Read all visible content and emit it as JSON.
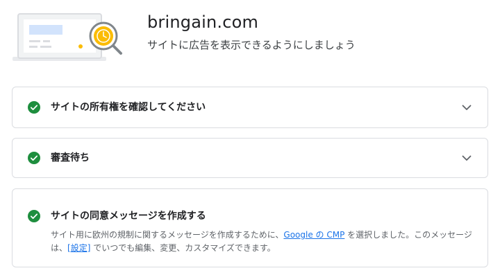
{
  "header": {
    "site_name": "bringain.com",
    "subtitle": "サイトに広告を表示できるようにしましょう"
  },
  "steps": [
    {
      "title": "サイトの所有権を確認してください",
      "status": "complete"
    },
    {
      "title": "審査待ち",
      "status": "complete"
    },
    {
      "title": "サイトの同意メッセージを作成する",
      "status": "complete",
      "desc_part1": "サイト用に欧州の規制に関するメッセージを作成するために、",
      "desc_link1": "Google の CMP",
      "desc_part2": " を選択しました。このメッセージは、",
      "desc_link2": "[設定]",
      "desc_part3": " でいつでも編集、変更、カスタマイズできます。"
    }
  ],
  "colors": {
    "success": "#1e8e3e",
    "link": "#1a73e8",
    "illustration_accent": "#fbbc04",
    "illustration_blue": "#d2e3fc"
  },
  "icons": {
    "status": "check-circle-icon",
    "expand": "chevron-down-icon",
    "illustration": "monitor-magnifier-illustration"
  }
}
